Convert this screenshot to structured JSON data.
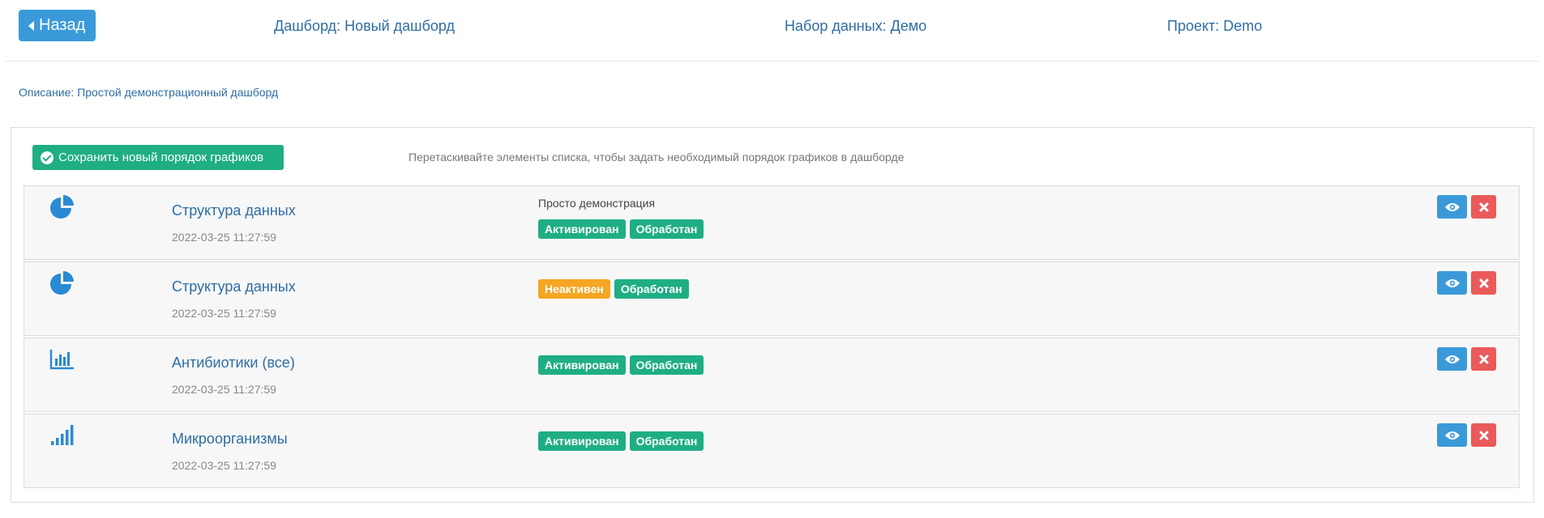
{
  "header": {
    "back_label": "Назад",
    "dashboard": "Дашборд: Новый дашборд",
    "dataset": "Набор данных: Демо",
    "project": "Проект: Demo"
  },
  "description": "Описание: Простой демонстрационный дашборд",
  "toolbar": {
    "save_label": "Сохранить новый порядок графиков",
    "hint": "Перетаскивайте элементы списка, чтобы задать необходимый порядок графиков в дашборде"
  },
  "charts": [
    {
      "icon": "pie-chart-icon",
      "title": "Структура данных",
      "date": "2022-03-25 11:27:59",
      "note": "Просто демонстрация",
      "status": "Активирован",
      "processed": "Обработан"
    },
    {
      "icon": "pie-chart-icon",
      "title": "Структура данных",
      "date": "2022-03-25 11:27:59",
      "note": "",
      "status": "Неактивен",
      "processed": "Обработан"
    },
    {
      "icon": "bar-chart-icon",
      "title": "Антибиотики (все)",
      "date": "2022-03-25 11:27:59",
      "note": "",
      "status": "Активирован",
      "processed": "Обработан"
    },
    {
      "icon": "signal-bars-icon",
      "title": "Микроорганизмы",
      "date": "2022-03-25 11:27:59",
      "note": "",
      "status": "Активирован",
      "processed": "Обработан"
    }
  ],
  "colors": {
    "primary": "#3a9ad9",
    "success": "#1fae84",
    "warning": "#f5a623",
    "danger": "#ea5a5a",
    "link": "#2e6da4"
  }
}
